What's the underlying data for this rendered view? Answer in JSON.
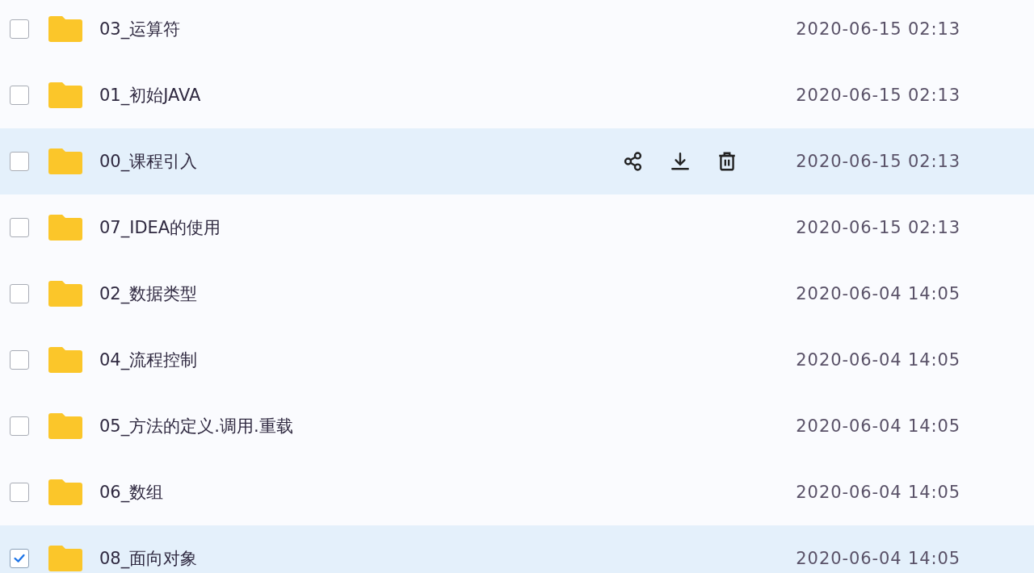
{
  "files": [
    {
      "name": "03_运算符",
      "date": "2020-06-15 02:13",
      "checked": false,
      "hovered": false
    },
    {
      "name": "01_初始JAVA",
      "date": "2020-06-15 02:13",
      "checked": false,
      "hovered": false
    },
    {
      "name": "00_课程引入",
      "date": "2020-06-15 02:13",
      "checked": false,
      "hovered": true
    },
    {
      "name": "07_IDEA的使用",
      "date": "2020-06-15 02:13",
      "checked": false,
      "hovered": false
    },
    {
      "name": "02_数据类型",
      "date": "2020-06-04 14:05",
      "checked": false,
      "hovered": false
    },
    {
      "name": "04_流程控制",
      "date": "2020-06-04 14:05",
      "checked": false,
      "hovered": false
    },
    {
      "name": "05_方法的定义.调用.重载",
      "date": "2020-06-04 14:05",
      "checked": false,
      "hovered": false
    },
    {
      "name": "06_数组",
      "date": "2020-06-04 14:05",
      "checked": false,
      "hovered": false
    },
    {
      "name": "08_面向对象",
      "date": "2020-06-04 14:05",
      "checked": true,
      "hovered": false
    }
  ]
}
